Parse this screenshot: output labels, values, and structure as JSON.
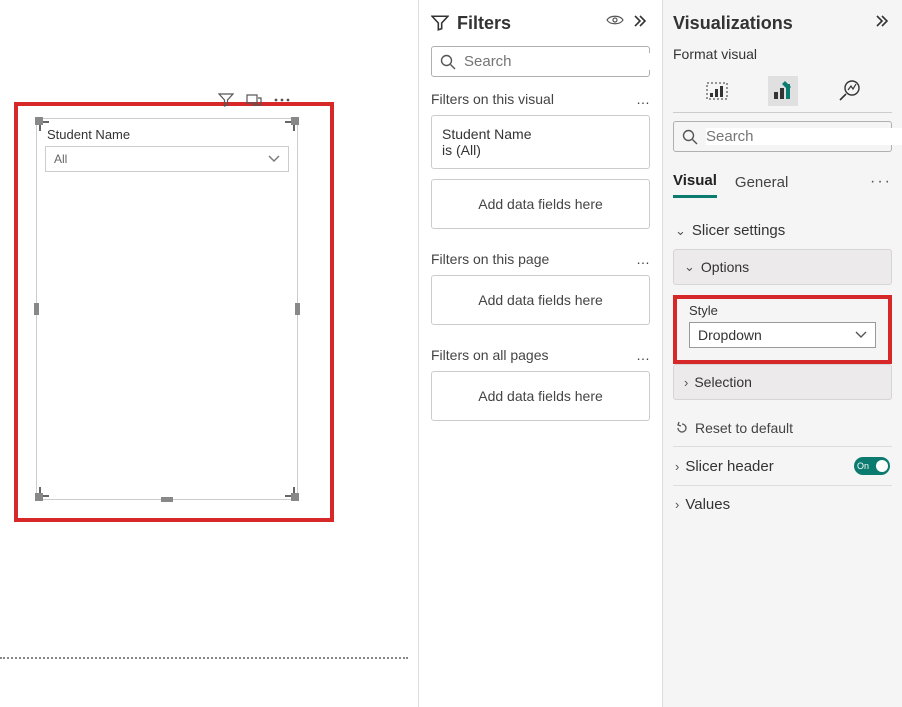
{
  "canvas": {
    "slicer": {
      "title": "Student Name",
      "dropdown_value": "All"
    }
  },
  "filters": {
    "title": "Filters",
    "search_placeholder": "Search",
    "sections": {
      "visual": {
        "label": "Filters on this visual",
        "cards": [
          {
            "field": "Student Name",
            "summary": "is (All)"
          }
        ],
        "add_label": "Add data fields here"
      },
      "page": {
        "label": "Filters on this page",
        "add_label": "Add data fields here"
      },
      "all": {
        "label": "Filters on all pages",
        "add_label": "Add data fields here"
      }
    }
  },
  "viz": {
    "title": "Visualizations",
    "subtitle": "Format visual",
    "search_placeholder": "Search",
    "tabs": {
      "visual": "Visual",
      "general": "General"
    },
    "sections": {
      "slicer_settings": "Slicer settings",
      "options": "Options",
      "style_label": "Style",
      "style_value": "Dropdown",
      "selection": "Selection",
      "reset": "Reset to default",
      "slicer_header": "Slicer header",
      "slicer_header_toggle": "On",
      "values": "Values"
    }
  }
}
